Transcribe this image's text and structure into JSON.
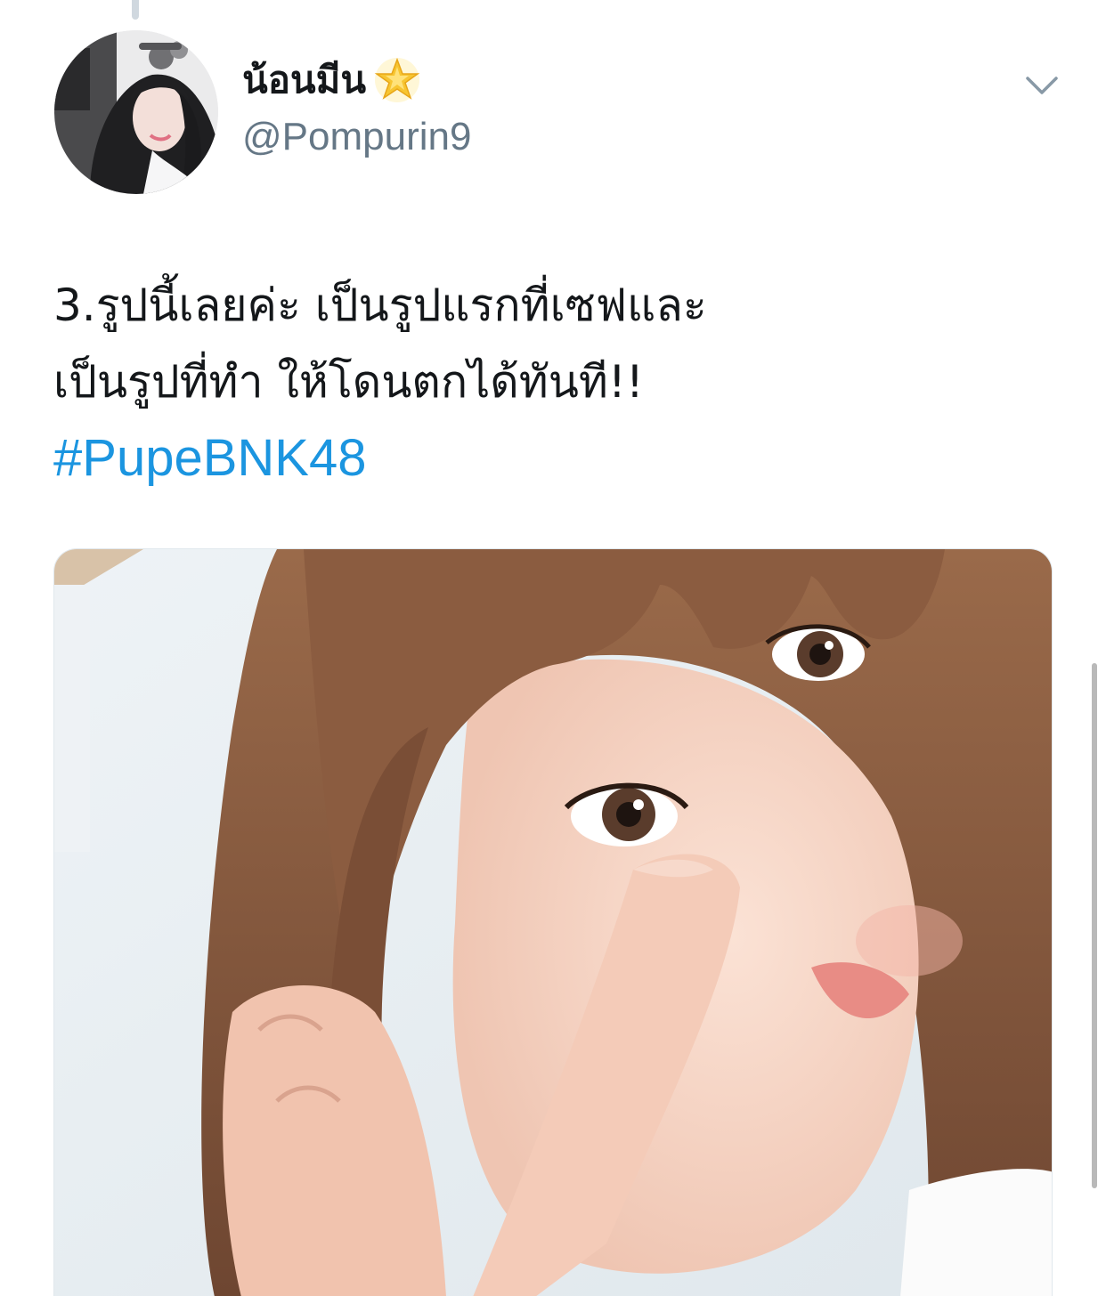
{
  "tweet": {
    "author": {
      "display_name": "น้อนมีน",
      "badge_icon": "star-icon",
      "handle": "@Pompurin9",
      "avatar_icon": "profile-photo"
    },
    "menu_icon": "chevron-down-icon",
    "text_lines": [
      "3.รูปนี้เลยค่ะ เป็นรูปแรกที่เซฟและ",
      "เป็นรูปที่ทำ ให้โดนตกได้ทันที!!"
    ],
    "hashtag": "#PupeBNK48",
    "media": {
      "type": "photo"
    }
  },
  "colors": {
    "text": "#14171a",
    "secondary_text": "#657786",
    "link": "#1b95e0",
    "chevron": "#8899a6",
    "star": "#f7c531"
  }
}
